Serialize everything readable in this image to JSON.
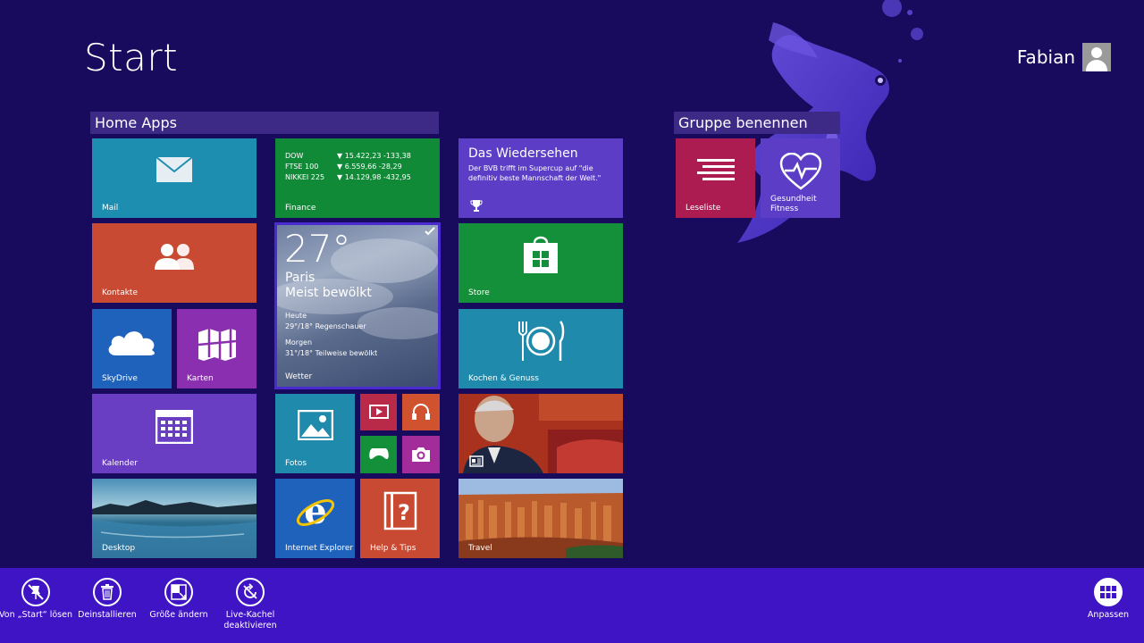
{
  "screen": {
    "title": "Start",
    "user": "Fabian"
  },
  "groups": [
    {
      "name": "Home Apps"
    },
    {
      "name": "Gruppe benennen"
    }
  ],
  "tiles": {
    "mail": {
      "label": "Mail",
      "color": "#1e8eb0",
      "icon": "mail-icon"
    },
    "finance": {
      "label": "Finance",
      "color": "#118a38",
      "rows": [
        {
          "name": "DOW",
          "value": "▼ 15.422,23 -133,38"
        },
        {
          "name": "FTSE 100",
          "value": "▼ 6.559,66 -28,29"
        },
        {
          "name": "NIKKEI 225",
          "value": "▼ 14.129,98 -432,95"
        }
      ]
    },
    "news": {
      "title": "Das Wiedersehen",
      "text": "Der BVB trifft im Supercup auf \"die definitiv beste Mannschaft der Welt.\"",
      "color": "#5b3ec5",
      "icon": "trophy-icon"
    },
    "kontakte": {
      "label": "Kontakte",
      "color": "#c84a33",
      "icon": "people-icon"
    },
    "weather": {
      "temp": "27°",
      "city": "Paris",
      "condition": "Meist bewölkt",
      "today_label": "Heute",
      "today": "29°/18° Regenschauer",
      "tomorrow_label": "Morgen",
      "tomorrow": "31°/18° Teilweise bewölkt",
      "label": "Wetter"
    },
    "store": {
      "label": "Store",
      "color": "#14903a",
      "icon": "store-bag-icon"
    },
    "skydrive": {
      "label": "SkyDrive",
      "color": "#1e62bc",
      "icon": "cloud-icon"
    },
    "karten": {
      "label": "Karten",
      "color": "#8a2fb0",
      "icon": "map-icon"
    },
    "kochen": {
      "label": "Kochen & Genuss",
      "color": "#1f8aab",
      "icon": "plate-icon"
    },
    "kalender": {
      "label": "Kalender",
      "color": "#6a3ec2",
      "icon": "calendar-icon"
    },
    "fotos": {
      "label": "Fotos",
      "color": "#1f8aab",
      "icon": "photo-icon"
    },
    "video": {
      "color": "#b82a48",
      "icon": "video-icon"
    },
    "musik": {
      "color": "#d0522f",
      "icon": "headphones-icon"
    },
    "spiele": {
      "color": "#14903a",
      "icon": "gamepad-icon"
    },
    "kamera": {
      "color": "#a22c9a",
      "icon": "camera-icon"
    },
    "desktop": {
      "label": "Desktop"
    },
    "ie": {
      "label": "Internet Explorer",
      "color": "#1e62bc",
      "icon": "ie-icon"
    },
    "help": {
      "label": "Help & Tips",
      "color": "#c84a33",
      "icon": "help-icon"
    },
    "travel": {
      "label": "Travel"
    },
    "leseliste": {
      "label": "Leseliste",
      "color": "#ad1c50",
      "icon": "reading-list-icon"
    },
    "gesundheit": {
      "label_line1": "Gesundheit",
      "label_line2": "Fitness",
      "color": "#5b3ec5",
      "icon": "heart-pulse-icon"
    }
  },
  "appbar": {
    "commands": [
      {
        "label": "Von „Start“ lösen",
        "icon": "unpin-icon"
      },
      {
        "label": "Deinstallieren",
        "icon": "trash-icon"
      },
      {
        "label": "Größe ändern",
        "icon": "resize-icon"
      },
      {
        "label": "Live-Kachel",
        "label2": "deaktivieren",
        "icon": "live-tile-off-icon"
      }
    ],
    "customize": {
      "label": "Anpassen",
      "icon": "customize-icon"
    }
  }
}
